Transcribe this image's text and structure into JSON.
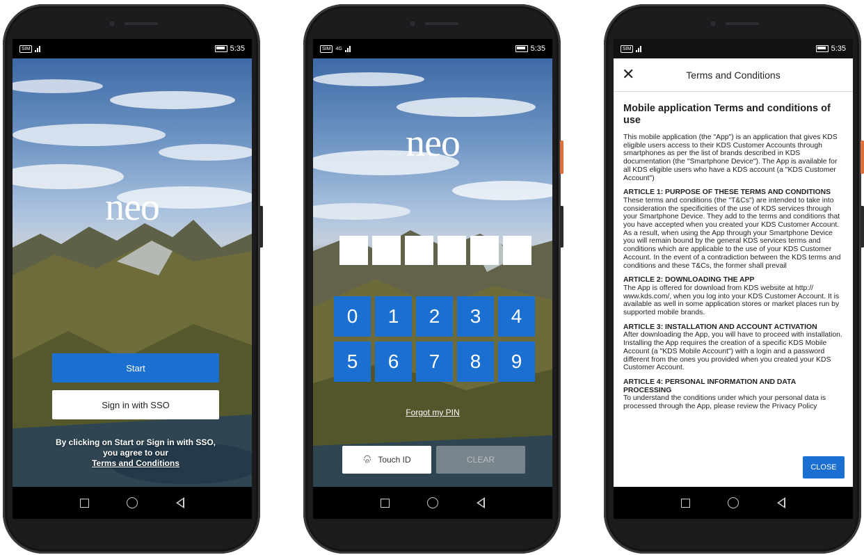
{
  "status_bar": {
    "time": "5:35",
    "sim_chip": "SIM",
    "network_label": "4G"
  },
  "screen1": {
    "logo": "neo",
    "start_button": "Start",
    "sso_button": "Sign in with SSO",
    "legal_line1": "By clicking on Start or Sign in with SSO,",
    "legal_line2": "you agree to our",
    "legal_link": "Terms and Conditions"
  },
  "screen2": {
    "logo": "neo",
    "keys": [
      "0",
      "1",
      "2",
      "3",
      "4",
      "5",
      "6",
      "7",
      "8",
      "9"
    ],
    "forgot_pin": "Forgot my PIN",
    "touch_id": "Touch ID",
    "clear": "CLEAR"
  },
  "screen3": {
    "header_title": "Terms and Conditions",
    "heading": "Mobile application Terms and conditions of use",
    "intro": "This mobile application (the \"App\") is an application that gives KDS eligible users access to their KDS Customer Accounts through smartphones as per the list of brands described in KDS documentation (the \"Smartphone Device\"). The App is available for all KDS eligible users who have a KDS account (a \"KDS Customer Account\")",
    "articles": [
      {
        "title": "ARTICLE 1: PURPOSE OF THESE TERMS AND CONDITIONS",
        "body": "These terms and conditions (the \"T&Cs\") are intended to take into consideration the specificities of the use of KDS services through your Smartphone Device. They add to the terms and conditions that you have accepted when you created your KDS Customer Account.",
        "body2": "As a result, when using the App through your Smartphone Device you will remain bound by the general KDS services terms and conditions which are applicable to the use of your KDS Customer Account. In the event of a contradiction between the KDS terms and conditions and these T&Cs, the former shall prevail"
      },
      {
        "title": "ARTICLE 2: DOWNLOADING THE APP",
        "body": "The App is offered for download from KDS website at http:// www.kds.com/, when you log into your KDS Customer Account. It is available as well in some application stores or market places run by supported mobile brands.",
        "body2": ""
      },
      {
        "title": "ARTICLE 3: INSTALLATION AND ACCOUNT ACTIVATION",
        "body": "After downloading the App, you will have to proceed with installation. Installing the App requires the creation of a specific KDS Mobile Account (a \"KDS Mobile Account\") with a login and a password different from the ones you provided when you created your KDS Customer Account.",
        "body2": ""
      },
      {
        "title": "ARTICLE 4: PERSONAL INFORMATION AND DATA PROCESSING",
        "body": "To understand the conditions under which your personal data is processed through the App, please review the Privacy Policy",
        "body2": ""
      }
    ],
    "close_button": "CLOSE"
  },
  "colors": {
    "accent": "#1a6fd1",
    "phone_body": "#1c1c1e",
    "side_button": "#e0703d"
  }
}
